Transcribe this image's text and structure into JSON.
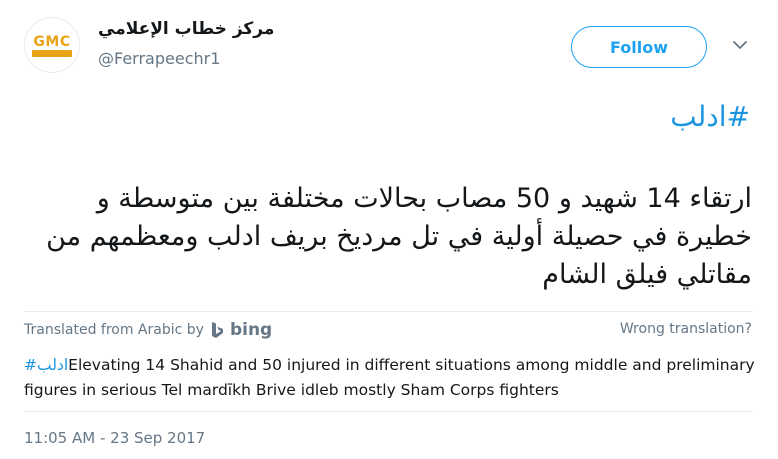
{
  "user": {
    "display_name": "مركز خطاب الإعلامي",
    "handle": "@Ferrapeechr1",
    "avatar_logo_text": "GMC",
    "follow_label": "Follow"
  },
  "tweet": {
    "hashtag": "#ادلب",
    "text": "ارتقاء 14 شهيد و 50 مصاب بحالات مختلفة بين متوسطة و خطيرة في حصيلة أولية في تل مرديخ بريف ادلب ومعظمهم من مقاتلي فيلق الشام",
    "timestamp": "11:05 AM - 23 Sep 2017"
  },
  "translation": {
    "source_label": "Translated from Arabic by",
    "provider": "bing",
    "wrong_label": "Wrong translation?",
    "hashtag": "#ادلب",
    "text": "Elevating 14 Shahid and 50 injured in different situations among middle and preliminary figures in serious Tel mardīkh Brive idleb mostly Sham Corps fighters"
  },
  "colors": {
    "accent": "#1da1f2",
    "link": "#1b95e0",
    "muted": "#657786",
    "logo": "#e8a317"
  },
  "icons": [
    "gmc-logo-icon",
    "chevron-down-icon",
    "bing-logo-icon"
  ]
}
